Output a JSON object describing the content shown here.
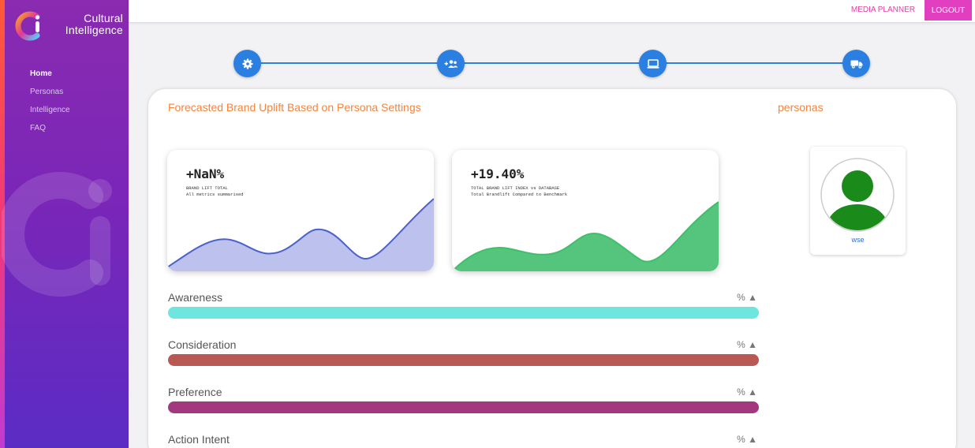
{
  "brand": {
    "line1": "Cultural",
    "line2": "Intelligence"
  },
  "nav": {
    "items": [
      {
        "label": "Home",
        "active": true
      },
      {
        "label": "Personas",
        "active": false
      },
      {
        "label": "Intelligence",
        "active": false
      },
      {
        "label": "FAQ",
        "active": false
      }
    ]
  },
  "topbar": {
    "media_planner": "MEDIA PLANNER",
    "logout": "LOGOUT"
  },
  "stepper": {
    "steps": [
      {
        "icon": "gear-icon"
      },
      {
        "icon": "add-users-icon"
      },
      {
        "icon": "laptop-icon"
      },
      {
        "icon": "truck-icon"
      }
    ],
    "color": "#2a7fe0"
  },
  "main": {
    "title": "Forecasted Brand Uplift Based on Persona Settings",
    "personas_title": "personas"
  },
  "metrics": [
    {
      "value": "+NaN%",
      "label1": "BRAND LIFT TOTAL",
      "label2": "All metrics summarised",
      "wave_color": "#bdc1ee",
      "line_color": "#4a62c9"
    },
    {
      "value": "+19.40%",
      "label1": "TOTAL BRAND LIFT INDEX vs DATABASE",
      "label2": "Total Brandlift Compared to Benchmark",
      "wave_color": "#55c57d",
      "line_color": "#3fbf6a"
    }
  ],
  "persona": {
    "name": "wse",
    "avatar_color": "#1a8a1a"
  },
  "bars": [
    {
      "label": "Awareness",
      "pct": "% ▲",
      "color": "#6ee6df"
    },
    {
      "label": "Consideration",
      "pct": "% ▲",
      "color": "#b85953"
    },
    {
      "label": "Preference",
      "pct": "% ▲",
      "color": "#a3387f"
    },
    {
      "label": "Action Intent",
      "pct": "% ▲",
      "color": "#4a9ad8"
    }
  ]
}
